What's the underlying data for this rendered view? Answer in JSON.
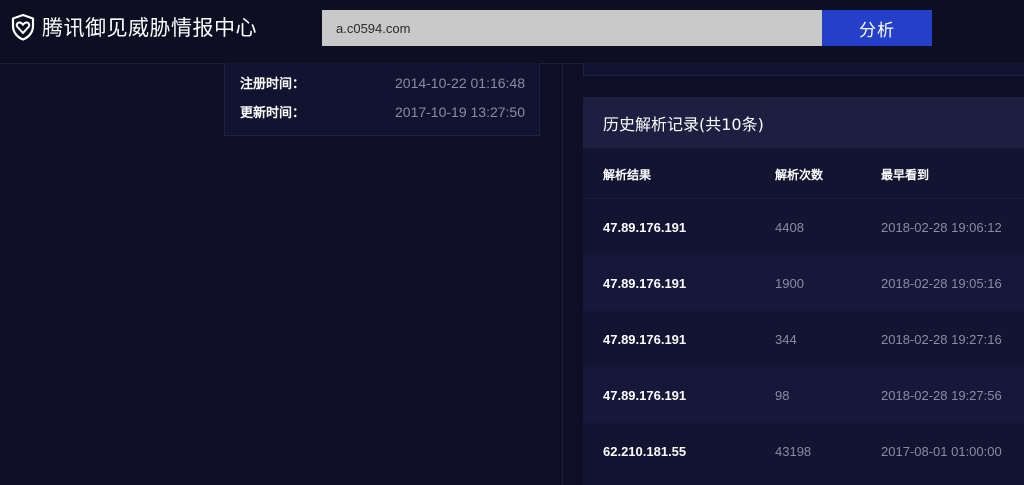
{
  "header": {
    "logo_text": "腾讯御见威胁情报中心",
    "search_value": "a.c0594.com",
    "analyze_label": "分析"
  },
  "domain_info": {
    "register_label": "注册时间：",
    "register_value": "2014-10-22 01:16:48",
    "update_label": "更新时间：",
    "update_value": "2017-10-19 13:27:50"
  },
  "history": {
    "title": "历史解析记录(共10条)",
    "columns": [
      "解析结果",
      "解析次数",
      "最早看到"
    ],
    "rows": [
      {
        "ip": "47.89.176.191",
        "count": "4408",
        "first_seen": "2018-02-28 19:06:12"
      },
      {
        "ip": "47.89.176.191",
        "count": "1900",
        "first_seen": "2018-02-28 19:05:16"
      },
      {
        "ip": "47.89.176.191",
        "count": "344",
        "first_seen": "2018-02-28 19:27:16"
      },
      {
        "ip": "47.89.176.191",
        "count": "98",
        "first_seen": "2018-02-28 19:27:56"
      },
      {
        "ip": "62.210.181.55",
        "count": "43198",
        "first_seen": "2017-08-01 01:00:00"
      }
    ]
  },
  "colors": {
    "background": "#0e0f26",
    "accent": "#2440c8"
  }
}
